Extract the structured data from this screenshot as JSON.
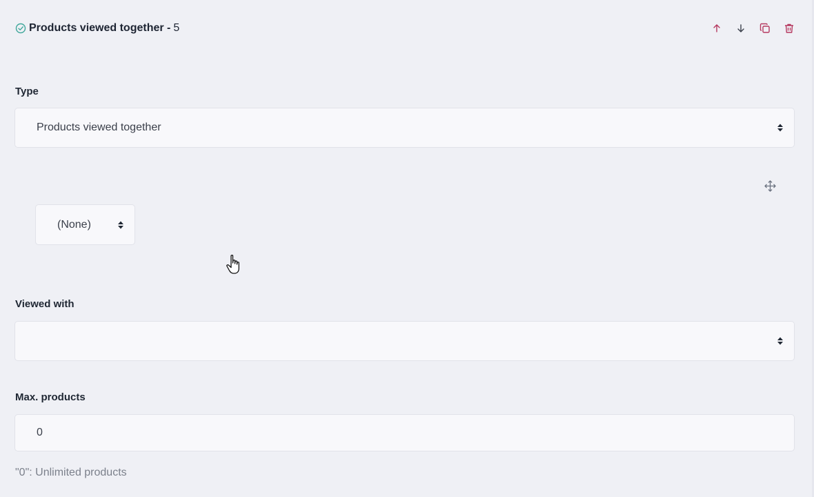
{
  "header": {
    "title": "Products viewed together -",
    "count": "5",
    "status_icon": "check-circle-icon"
  },
  "toolbar": {
    "move_up_icon": "arrow-up-icon",
    "move_down_icon": "arrow-down-icon",
    "duplicate_icon": "copy-icon",
    "delete_icon": "trash-icon",
    "accent_color": "#b5385f"
  },
  "type_field": {
    "label": "Type",
    "value": "Products viewed together"
  },
  "sub_select": {
    "value": "(None)",
    "handle_icon": "move-handle-icon"
  },
  "viewed_with_field": {
    "label": "Viewed with",
    "value": ""
  },
  "max_products_field": {
    "label": "Max. products",
    "value": "0",
    "help": "\"0\": Unlimited products"
  }
}
